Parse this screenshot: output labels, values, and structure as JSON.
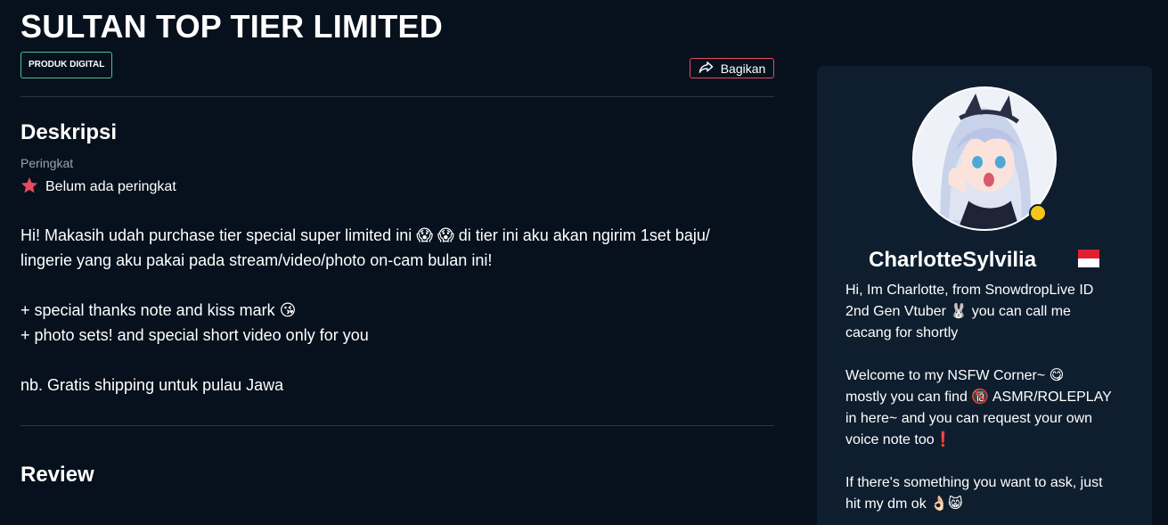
{
  "product": {
    "title": "SULTAN TOP TIER LIMITED",
    "tag": "PRODUK DIGITAL",
    "share_label": "Bagikan"
  },
  "description": {
    "heading": "Deskripsi",
    "rating_label": "Peringkat",
    "rating_text": "Belum ada peringkat",
    "lines": [
      "Hi! Makasih udah purchase tier special super limited ini 😱 😱  di tier ini aku akan ngirim 1set baju/",
      "lingerie yang aku pakai pada stream/video/photo on-cam bulan ini!",
      "",
      "+ special thanks note and kiss mark 😘",
      "+ photo sets! and special short video only for you",
      "",
      "nb. Gratis shipping untuk pulau Jawa"
    ]
  },
  "review": {
    "heading": "Review"
  },
  "creator": {
    "name": "CharlotteSylvilia",
    "status": "online",
    "flag": "indonesia-flag",
    "bio_lines": [
      "Hi, Im Charlotte, from SnowdropLive ID",
      "2nd Gen Vtuber 🐰 you can call me",
      "cacang for shortly",
      "",
      "Welcome to my NSFW Corner~ 😋",
      "mostly you can find 🔞 ASMR/ROLEPLAY",
      "in here~ and you can request your own",
      "voice note too❗",
      "",
      "If there's something you want to ask, just",
      "hit my dm ok 👌🏻😸"
    ]
  },
  "colors": {
    "background": "#06111d",
    "card": "#0e1e2e",
    "tag_border": "#4fbf8a",
    "share_border": "#e94a62",
    "star": "#e94a62",
    "online": "#f5c518"
  }
}
